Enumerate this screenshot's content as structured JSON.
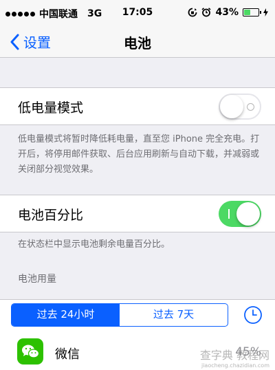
{
  "status_bar": {
    "carrier": "中国联通",
    "network": "3G",
    "time": "17:05",
    "battery_percent": "43%",
    "battery_level": 0.43
  },
  "nav": {
    "back_label": "设置",
    "title": "电池"
  },
  "low_power": {
    "label": "低电量模式",
    "enabled": false,
    "description": "低电量模式将暂时降低耗电量，直至您 iPhone 完全充电。打开后，将停用邮件获取、后台应用刷新与自动下载，并减弱或关闭部分视觉效果。"
  },
  "battery_percentage": {
    "label": "电池百分比",
    "enabled": true,
    "description": "在状态栏中显示电池剩余电量百分比。"
  },
  "usage": {
    "header": "电池用量",
    "segments": [
      "过去 24小时",
      "过去 7天"
    ],
    "selected_segment": 0,
    "apps": [
      {
        "name": "微信",
        "percent": "45%"
      }
    ]
  },
  "watermark": {
    "main": "查字典 教程网",
    "sub": "jiaocheng.chazidian.com"
  },
  "colors": {
    "accent": "#0a60ff",
    "switch_on": "#4cd964",
    "wechat": "#2dc100"
  }
}
